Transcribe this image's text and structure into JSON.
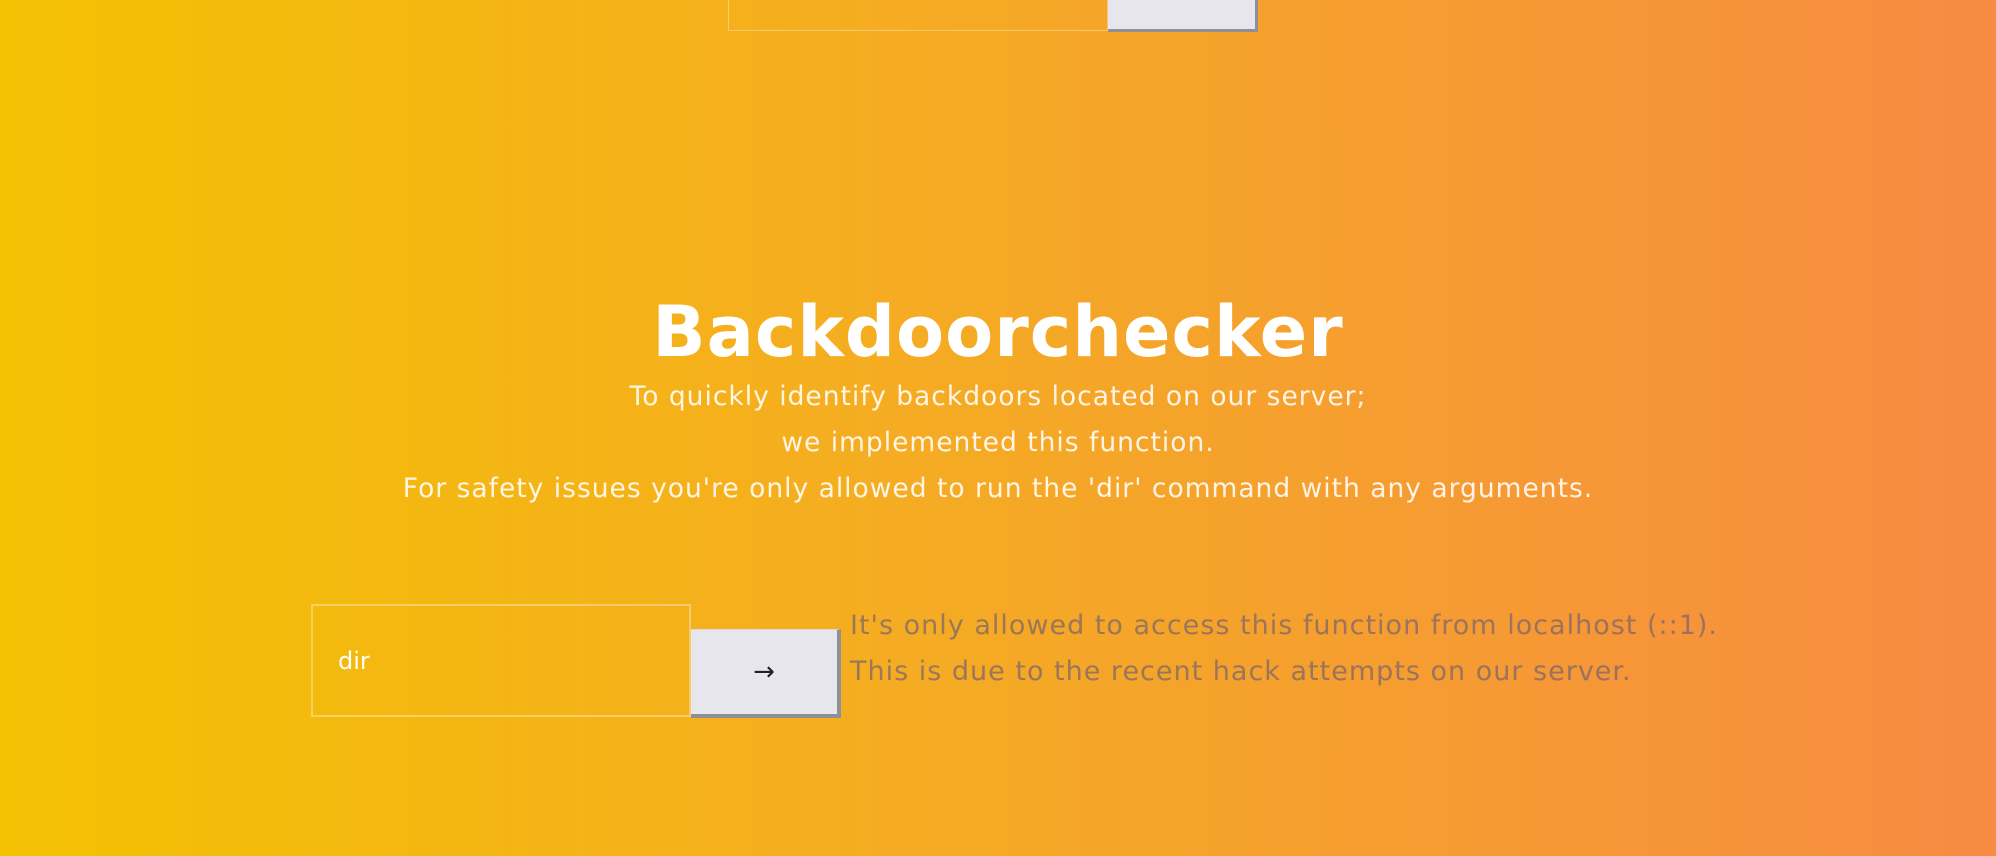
{
  "top_form": {
    "input_value": "",
    "button_label": ""
  },
  "header": {
    "title": "Backdoorchecker",
    "description": [
      "To quickly identify backdoors located on our server;",
      "we implemented this function.",
      "For safety issues you're only allowed to run the 'dir' command with any arguments."
    ]
  },
  "command_form": {
    "input_value": "dir",
    "submit_label": "→"
  },
  "notice": {
    "lines": [
      "It's only allowed to access this function from localhost (::1).",
      "This is due to the recent hack attempts on our server."
    ]
  },
  "colors": {
    "gradient_start": "#f4c102",
    "gradient_end": "#f68b42",
    "button_face": "#e6e6ec",
    "button_shadow": "#8f8f98"
  }
}
